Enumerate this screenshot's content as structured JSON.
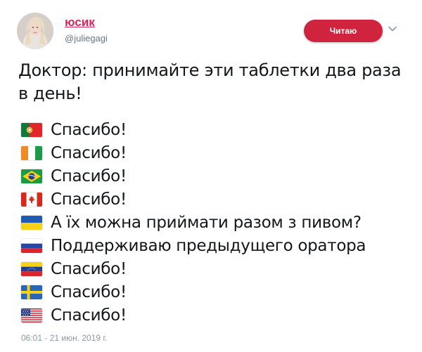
{
  "author": {
    "display_name": "юсик",
    "handle": "@juliegagi"
  },
  "follow_button": {
    "label": "Читаю"
  },
  "tweet": {
    "text": "Доктор: принимайте эти таблетки два раза в день!",
    "replies": [
      {
        "flag": "portugal-flag-icon",
        "text": "Спасибо!"
      },
      {
        "flag": "ivory-coast-flag-icon",
        "text": "Спасибо!"
      },
      {
        "flag": "brazil-flag-icon",
        "text": "Спасибо!"
      },
      {
        "flag": "canada-flag-icon",
        "text": "Спасибо!"
      },
      {
        "flag": "ukraine-flag-icon",
        "text": "А їх можна приймати разом з пивом?"
      },
      {
        "flag": "russia-flag-icon",
        "text": "Поддерживаю предыдущего оратора"
      },
      {
        "flag": "venezuela-flag-icon",
        "text": "Спасибо!"
      },
      {
        "flag": "sweden-flag-icon",
        "text": "Спасибо!"
      },
      {
        "flag": "usa-flag-icon",
        "text": "Спасибо!"
      }
    ],
    "timestamp": "06:01 - 21 июн. 2019 г."
  },
  "colors": {
    "display_name": "#e0245e",
    "follow_button_bg": "#d0243e",
    "handle": "#657786",
    "timestamp": "#8899a6"
  }
}
